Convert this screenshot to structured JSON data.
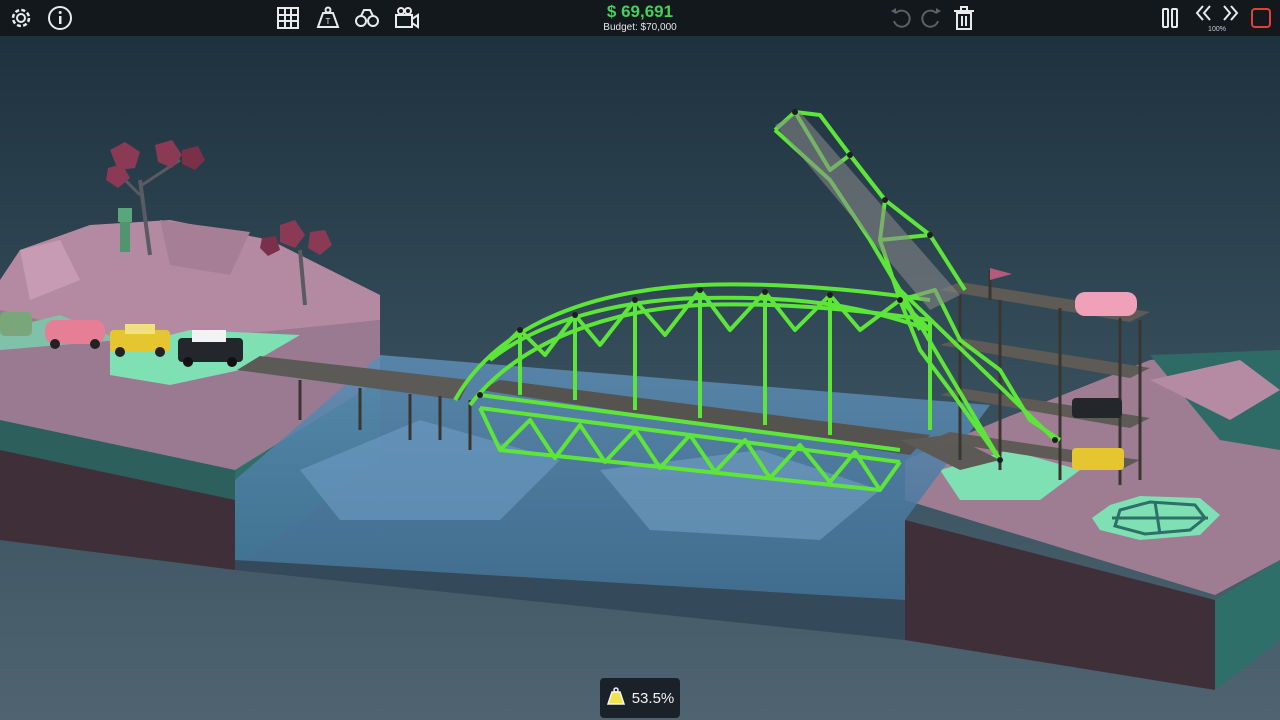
{
  "hud": {
    "cost": "$ 69,691",
    "budget": "Budget: $70,000",
    "speed": "100%",
    "stress": "53.5%"
  },
  "icons": {
    "left": [
      "gear-icon",
      "info-icon"
    ],
    "center": [
      "materials-grid-icon",
      "weight-icon",
      "binoculars-icon",
      "camera-icon"
    ],
    "history": [
      "undo-icon",
      "redo-icon",
      "trash-icon"
    ],
    "right": [
      "pause-icon",
      "slow-down-icon",
      "speed-up-icon",
      "stop-icon"
    ]
  },
  "colors": {
    "money": "#45d15a",
    "beam": "#5ee53a",
    "stop": "#e2403c"
  }
}
